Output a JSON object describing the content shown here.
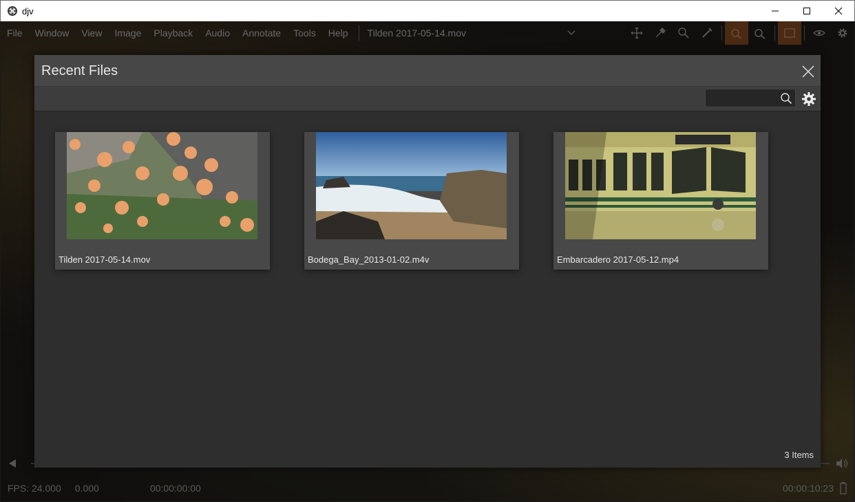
{
  "window": {
    "title": "djv"
  },
  "menu": {
    "items": [
      "File",
      "Window",
      "View",
      "Image",
      "Playback",
      "Audio",
      "Annotate",
      "Tools",
      "Help"
    ],
    "current_file": "Tilden 2017-05-14.mov"
  },
  "status": {
    "fps": "FPS: 24.000",
    "value": "0.000",
    "current_time": "00:00:00:00",
    "duration": "00:00:10:23"
  },
  "dialog": {
    "title": "Recent Files",
    "search": {
      "value": "",
      "placeholder": ""
    },
    "items": [
      {
        "label": "Tilden 2017-05-14.mov",
        "thumbnail": "orange-poppies"
      },
      {
        "label": "Bodega_Bay_2013-01-02.m4v",
        "thumbnail": "ocean-beach"
      },
      {
        "label": "Embarcadero 2017-05-12.mp4",
        "thumbnail": "yellow-streetcar"
      }
    ],
    "count_label": "3 Items"
  },
  "colors": {
    "dialog_bg": "#2e2e2e",
    "header_bg": "#474747",
    "item_bg": "#484848",
    "active_tool": "#4a2a12"
  }
}
